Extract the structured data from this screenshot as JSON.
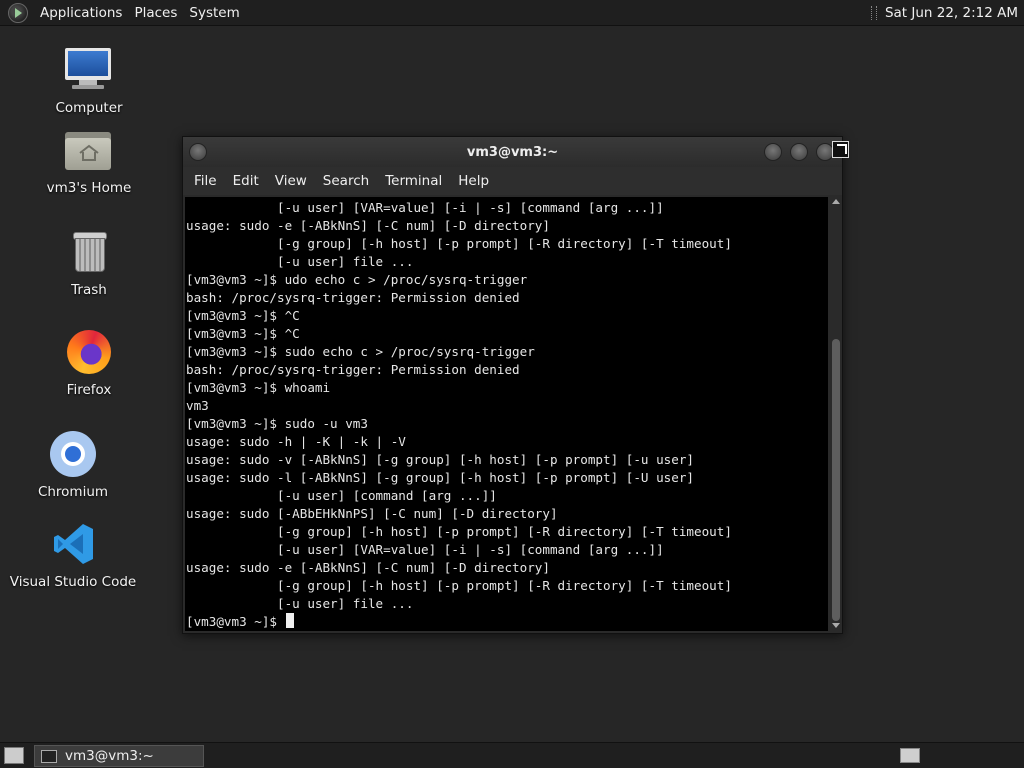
{
  "top_panel": {
    "menus": [
      "Applications",
      "Places",
      "System"
    ],
    "clock": "Sat Jun 22,  2:12 AM"
  },
  "desktop_icons": [
    {
      "label": "Computer",
      "icon": "computer-icon"
    },
    {
      "label": "vm3's Home",
      "icon": "home-folder-icon"
    },
    {
      "label": "Trash",
      "icon": "trash-icon"
    },
    {
      "label": "Firefox",
      "icon": "firefox-icon"
    },
    {
      "label": "Chromium",
      "icon": "chromium-icon"
    },
    {
      "label": "Visual Studio Code",
      "icon": "vscode-icon"
    }
  ],
  "terminal": {
    "title": "vm3@vm3:~",
    "menu": [
      "File",
      "Edit",
      "View",
      "Search",
      "Terminal",
      "Help"
    ],
    "lines": [
      "            [-u user] [VAR=value] [-i | -s] [command [arg ...]]",
      "usage: sudo -e [-ABkNnS] [-C num] [-D directory]",
      "            [-g group] [-h host] [-p prompt] [-R directory] [-T timeout]",
      "            [-u user] file ...",
      "[vm3@vm3 ~]$ udo echo c > /proc/sysrq-trigger",
      "bash: /proc/sysrq-trigger: Permission denied",
      "[vm3@vm3 ~]$ ^C",
      "[vm3@vm3 ~]$ ^C",
      "[vm3@vm3 ~]$ sudo echo c > /proc/sysrq-trigger",
      "bash: /proc/sysrq-trigger: Permission denied",
      "[vm3@vm3 ~]$ whoami",
      "vm3",
      "[vm3@vm3 ~]$ sudo -u vm3",
      "usage: sudo -h | -K | -k | -V",
      "usage: sudo -v [-ABkNnS] [-g group] [-h host] [-p prompt] [-u user]",
      "usage: sudo -l [-ABkNnS] [-g group] [-h host] [-p prompt] [-U user]",
      "            [-u user] [command [arg ...]]",
      "usage: sudo [-ABbEHkNnPS] [-C num] [-D directory]",
      "            [-g group] [-h host] [-p prompt] [-R directory] [-T timeout]",
      "            [-u user] [VAR=value] [-i | -s] [command [arg ...]]",
      "usage: sudo -e [-ABkNnS] [-C num] [-D directory]",
      "            [-g group] [-h host] [-p prompt] [-R directory] [-T timeout]",
      "            [-u user] file ..."
    ],
    "prompt": "[vm3@vm3 ~]$ "
  },
  "bottom_panel": {
    "task_label": "vm3@vm3:~"
  }
}
